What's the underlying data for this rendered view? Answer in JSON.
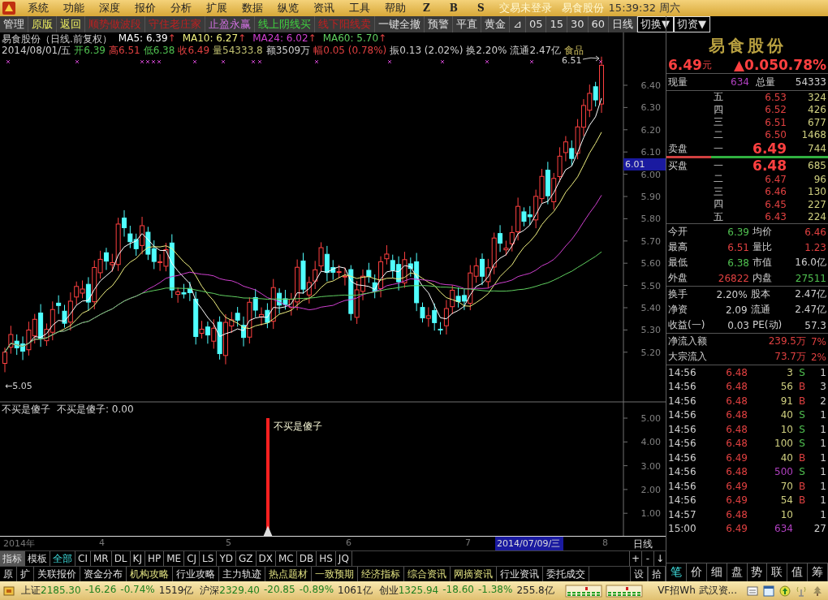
{
  "menu": {
    "items": [
      "系统",
      "功能",
      "深度",
      "报价",
      "分析",
      "扩展",
      "数据",
      "纵览",
      "资讯",
      "工具",
      "帮助"
    ],
    "trade_buttons": [
      "Z",
      "B",
      "S"
    ],
    "login_status": "交易未登录",
    "stock": "易食股份",
    "clock": "15:39:32 周六"
  },
  "toolbar": [
    {
      "label": "管理",
      "kind": "plain"
    },
    {
      "label": "原版",
      "kind": "option"
    },
    {
      "label": "返回",
      "kind": "option"
    },
    {
      "label": "顺势做波段",
      "kind": "sell"
    },
    {
      "label": "守住老庄家",
      "kind": "sell"
    },
    {
      "label": "止盈永赢",
      "kind": "profit"
    },
    {
      "label": "线上阴线买",
      "kind": "buy"
    },
    {
      "label": "线下阳线卖",
      "kind": "sell"
    },
    {
      "label": "一键全撤",
      "kind": "plain"
    },
    {
      "label": "预警",
      "kind": "plain"
    },
    {
      "label": "平直",
      "kind": "plain"
    },
    {
      "label": "黄金",
      "kind": "plain"
    },
    {
      "label": "⊿",
      "kind": "plain"
    },
    {
      "label": "05",
      "kind": "plain"
    },
    {
      "label": "15",
      "kind": "plain"
    },
    {
      "label": "30",
      "kind": "plain"
    },
    {
      "label": "60",
      "kind": "plain"
    },
    {
      "label": "日线",
      "kind": "plain"
    },
    {
      "label": "切换▼",
      "kind": "dropdown"
    },
    {
      "label": "切资▼",
      "kind": "dropdown"
    }
  ],
  "chart": {
    "title": "易食股份（日线.前复权）",
    "ma": [
      {
        "label": "MA5: 6.39",
        "arrow": "↑",
        "color": "#ffffff"
      },
      {
        "label": "MA10: 6.27",
        "arrow": "↑",
        "color": "#f0f080"
      },
      {
        "label": "MA24: 6.02",
        "arrow": "↑",
        "color": "#d040d0"
      },
      {
        "label": "MA60: 5.70",
        "arrow": "↑",
        "color": "#60d060"
      }
    ],
    "info": [
      {
        "text": "2014/08/01/五",
        "color": "#d0d0d0"
      },
      {
        "text": "开6.39",
        "color": "#50c050"
      },
      {
        "text": "高6.51",
        "color": "#e04040"
      },
      {
        "text": "低6.38",
        "color": "#50c050"
      },
      {
        "text": "收6.49",
        "color": "#e04040"
      },
      {
        "text": "量54333.8",
        "color": "#c0c070"
      },
      {
        "text": "额3509万",
        "color": "#d0d0d0"
      },
      {
        "text": "幅0.05 (0.78%)",
        "color": "#e04040"
      },
      {
        "text": "振0.13 (2.02%)",
        "color": "#d0d0d0"
      },
      {
        "text": "换2.20%",
        "color": "#d0d0d0"
      },
      {
        "text": "流通2.47亿",
        "color": "#d0d0d0"
      },
      {
        "text": "食品",
        "color": "#d0c060"
      }
    ],
    "high_label": "6.51",
    "low_label": "←5.05",
    "price_axis": [
      "6.40",
      "6.30",
      "6.20",
      "6.10",
      "6.00",
      "5.90",
      "5.80",
      "5.70",
      "5.60",
      "5.50",
      "5.40",
      "5.30",
      "5.20"
    ],
    "crosshair_price": "6.01",
    "indicator": {
      "name": "不买是傻子",
      "reading": "不买是傻子: 0.00",
      "signal_label": "不买是傻子",
      "axis": [
        "5.00",
        "4.00",
        "3.00",
        "2.00",
        "1.00"
      ]
    },
    "date_axis": [
      "2014年",
      "4",
      "5",
      "6",
      "7",
      "8"
    ],
    "crosshair_date": "2014/07/09/三",
    "period_label": "日线"
  },
  "indicator_tabs": [
    {
      "label": "指标",
      "selected": false
    },
    {
      "label": "模板",
      "selected": false
    },
    {
      "label": "全部",
      "selected": true
    },
    {
      "label": "CI",
      "selected": false
    },
    {
      "label": "MR",
      "selected": false
    },
    {
      "label": "DL",
      "selected": false
    },
    {
      "label": "KJ",
      "selected": false
    },
    {
      "label": "HP",
      "selected": false
    },
    {
      "label": "ME",
      "selected": false
    },
    {
      "label": "CJ",
      "selected": false
    },
    {
      "label": "LS",
      "selected": false
    },
    {
      "label": "YD",
      "selected": false
    },
    {
      "label": "GZ",
      "selected": false
    },
    {
      "label": "DX",
      "selected": false
    },
    {
      "label": "MC",
      "selected": false
    },
    {
      "label": "DB",
      "selected": false
    },
    {
      "label": "HS",
      "selected": false
    },
    {
      "label": "JQ",
      "selected": false
    }
  ],
  "zoom_buttons": [
    "+",
    "-",
    "↓"
  ],
  "info_tabs": [
    {
      "label": "原",
      "highlighted": false
    },
    {
      "label": "扩",
      "highlighted": false
    },
    {
      "label": "关联报价",
      "highlighted": false
    },
    {
      "label": "资金分布",
      "highlighted": false
    },
    {
      "label": "机构攻略",
      "highlighted": true
    },
    {
      "label": "行业攻略",
      "highlighted": false
    },
    {
      "label": "主力轨迹",
      "highlighted": false
    },
    {
      "label": "热点题材",
      "highlighted": true
    },
    {
      "label": "一致预期",
      "highlighted": true
    },
    {
      "label": "经济指标",
      "highlighted": true
    },
    {
      "label": "综合资讯",
      "highlighted": true
    },
    {
      "label": "网摘资讯",
      "highlighted": true
    },
    {
      "label": "行业资讯",
      "highlighted": false
    },
    {
      "label": "委托成交",
      "highlighted": false
    }
  ],
  "side_buttons": [
    "设",
    "拾"
  ],
  "quote": {
    "name": "易食股份",
    "price": "6.49",
    "unit": "元",
    "change": "▲0.05",
    "pct": "0.78%",
    "volume_label": "现量",
    "volume": "634",
    "total_label": "总量",
    "total": "54333",
    "sell_label": "卖盘",
    "buy_label": "买盘",
    "asks": [
      {
        "level": "五",
        "price": "6.53",
        "qty": "324"
      },
      {
        "level": "四",
        "price": "6.52",
        "qty": "426"
      },
      {
        "level": "三",
        "price": "6.51",
        "qty": "677"
      },
      {
        "level": "二",
        "price": "6.50",
        "qty": "1468"
      },
      {
        "level": "一",
        "price": "6.49",
        "qty": "744"
      }
    ],
    "bids": [
      {
        "level": "一",
        "price": "6.48",
        "qty": "685"
      },
      {
        "level": "二",
        "price": "6.47",
        "qty": "96"
      },
      {
        "level": "三",
        "price": "6.46",
        "qty": "130"
      },
      {
        "level": "四",
        "price": "6.45",
        "qty": "227"
      },
      {
        "level": "五",
        "price": "6.43",
        "qty": "224"
      }
    ],
    "stats": [
      [
        {
          "label": "今开",
          "value": "6.39",
          "color": "#50c050"
        },
        {
          "label": "均价",
          "value": "6.46",
          "color": "#e04040"
        }
      ],
      [
        {
          "label": "最高",
          "value": "6.51",
          "color": "#e04040"
        },
        {
          "label": "量比",
          "value": "1.23",
          "color": "#e04040"
        }
      ],
      [
        {
          "label": "最低",
          "value": "6.38",
          "color": "#50c050"
        },
        {
          "label": "市值",
          "value": "16.0亿",
          "color": "#d0d0d0"
        }
      ],
      [
        {
          "label": "外盘",
          "value": "26822",
          "color": "#e04040"
        },
        {
          "label": "内盘",
          "value": "27511",
          "color": "#50c050"
        }
      ]
    ],
    "stats2": [
      [
        {
          "label": "换手",
          "value": "2.20%"
        },
        {
          "label": "股本",
          "value": "2.47亿"
        }
      ],
      [
        {
          "label": "净资",
          "value": "2.09"
        },
        {
          "label": "流通",
          "value": "2.47亿"
        }
      ],
      [
        {
          "label": "收益(一)",
          "value": "0.03"
        },
        {
          "label": "PE(动)",
          "value": "57.3"
        }
      ]
    ],
    "flows": [
      {
        "label": "净流入额",
        "value": "239.5万",
        "pct": "7%"
      },
      {
        "label": "大宗流入",
        "value": "73.7万",
        "pct": "2%"
      }
    ]
  },
  "ticks": [
    {
      "time": "14:56",
      "price": "6.48",
      "volume": "3",
      "side": "S",
      "large": false,
      "count": "1"
    },
    {
      "time": "14:56",
      "price": "6.48",
      "volume": "56",
      "side": "B",
      "large": false,
      "count": "3"
    },
    {
      "time": "14:56",
      "price": "6.48",
      "volume": "91",
      "side": "B",
      "large": false,
      "count": "2"
    },
    {
      "time": "14:56",
      "price": "6.48",
      "volume": "40",
      "side": "S",
      "large": false,
      "count": "1"
    },
    {
      "time": "14:56",
      "price": "6.48",
      "volume": "10",
      "side": "S",
      "large": false,
      "count": "1"
    },
    {
      "time": "14:56",
      "price": "6.48",
      "volume": "100",
      "side": "S",
      "large": false,
      "count": "1"
    },
    {
      "time": "14:56",
      "price": "6.49",
      "volume": "40",
      "side": "B",
      "large": false,
      "count": "1"
    },
    {
      "time": "14:56",
      "price": "6.48",
      "volume": "500",
      "side": "S",
      "large": true,
      "count": "1"
    },
    {
      "time": "14:56",
      "price": "6.49",
      "volume": "70",
      "side": "B",
      "large": false,
      "count": "1"
    },
    {
      "time": "14:56",
      "price": "6.49",
      "volume": "54",
      "side": "B",
      "large": false,
      "count": "1"
    },
    {
      "time": "14:57",
      "price": "6.48",
      "volume": "10",
      "large": false,
      "count": "1"
    },
    {
      "time": "15:00",
      "price": "6.49",
      "volume": "634",
      "large": true,
      "count": "27"
    }
  ],
  "detail_tabs": [
    {
      "label": "笔",
      "selected": true
    },
    {
      "label": "价",
      "selected": false
    },
    {
      "label": "细",
      "selected": false
    },
    {
      "label": "盘",
      "selected": false
    },
    {
      "label": "势",
      "selected": false
    },
    {
      "label": "联",
      "selected": false
    },
    {
      "label": "值",
      "selected": false
    },
    {
      "label": "筹",
      "selected": false
    }
  ],
  "status_bar": {
    "indices": [
      {
        "name": "上证",
        "value": "2185.30",
        "change": "-16.26",
        "pct": "-0.74%",
        "amount": "1519亿"
      },
      {
        "name": "沪深",
        "value": "2329.40",
        "change": "-20.85",
        "pct": "-0.89%",
        "amount": "1061亿"
      },
      {
        "name": "创业",
        "value": "1325.94",
        "change": "-18.60",
        "pct": "-1.38%",
        "amount": "255.8亿"
      }
    ],
    "news": "VF招Wh 武汉资..."
  }
}
